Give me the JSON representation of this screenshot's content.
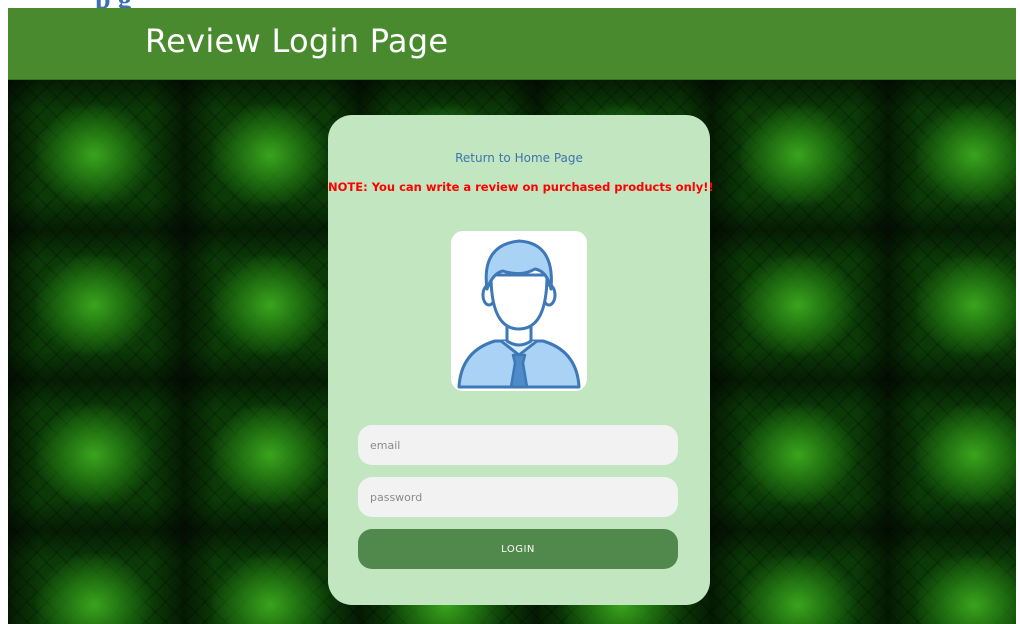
{
  "document": {
    "caption_fragment": "p                      g"
  },
  "header": {
    "title": "Review Login Page",
    "background_color": "#4a8a2e"
  },
  "card": {
    "home_link": "Return to Home Page",
    "note": "NOTE: You can write a review on purchased products only!!",
    "avatar_icon": "user-avatar-icon",
    "background_color": "#c2e6bf"
  },
  "form": {
    "email_placeholder": "email",
    "email_value": "",
    "password_placeholder": "password",
    "password_value": "",
    "login_label": "LOGIN",
    "login_color": "#50894b"
  },
  "colors": {
    "link": "#3f74b0",
    "note": "#ff0000",
    "backdrop": "#0b3a07"
  }
}
